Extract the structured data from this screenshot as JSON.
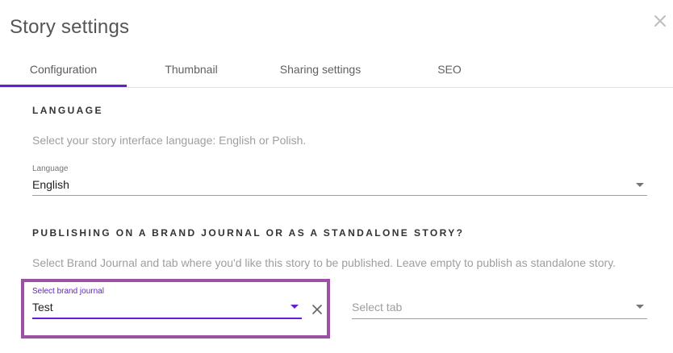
{
  "dialog": {
    "title": "Story settings"
  },
  "tabs": [
    {
      "label": "Configuration",
      "active": true
    },
    {
      "label": "Thumbnail",
      "active": false
    },
    {
      "label": "Sharing settings",
      "active": false
    },
    {
      "label": "SEO",
      "active": false
    }
  ],
  "language_section": {
    "heading": "LANGUAGE",
    "description": "Select your story interface language: English or Polish.",
    "field": {
      "label": "Language",
      "value": "English"
    }
  },
  "publishing_section": {
    "heading": "PUBLISHING ON A BRAND JOURNAL OR AS A STANDALONE STORY?",
    "description": "Select Brand Journal and tab where you'd like this story to be published. Leave empty to publish as standalone story.",
    "brand_journal": {
      "label": "Select brand journal",
      "value": "Test"
    },
    "tab_select": {
      "placeholder": "Select tab"
    }
  },
  "colors": {
    "accent": "#6a1bd6",
    "highlight": "#9b52a5"
  },
  "icons": {
    "close": "close-icon",
    "clear": "clear-icon",
    "dropdown": "dropdown-arrow-icon"
  }
}
